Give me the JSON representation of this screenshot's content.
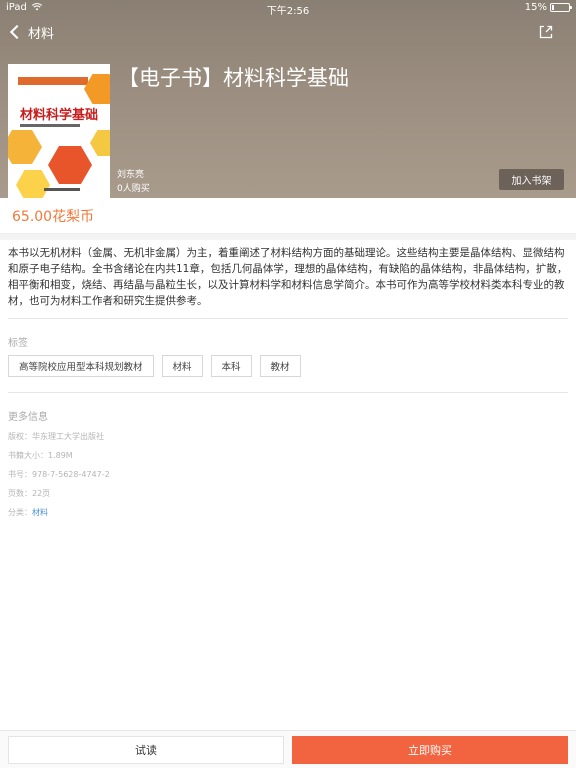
{
  "status_bar": {
    "device": "iPad",
    "time": "下午2:56",
    "battery": "15%",
    "battery_level": 0.15
  },
  "nav": {
    "back_label": "材料",
    "back_icon": "chevron-left-icon",
    "share_icon": "share-icon"
  },
  "book": {
    "title": "【电子书】材料科学基础",
    "cover_title": "材料科学基础",
    "author": "刘东亮",
    "buyers": "0人购买",
    "add_to_shelf": "加入书架",
    "price": "65.00花梨币"
  },
  "description": "本书以无机材料（金属、无机非金属）为主，着重阐述了材料结构方面的基础理论。这些结构主要是晶体结构、显微结构和原子电子结构。全书含绪论在内共11章，包括几何晶体学，理想的晶体结构，有缺陷的晶体结构，非晶体结构，扩散，相平衡和相变，烧结、再结晶与晶粒生长，以及计算材料学和材料信息学简介。本书可作为高等学校材料类本科专业的教材，也可为材料工作者和研究生提供参考。",
  "tags": {
    "title": "标签",
    "items": [
      "高等院校应用型本科规划教材",
      "材料",
      "本科",
      "教材"
    ]
  },
  "more_info": {
    "title": "更多信息",
    "copyright": "版权：华东理工大学出版社",
    "size": "书籍大小：1.89M",
    "isbn": "书号：978-7-5628-4747-2",
    "pages": "页数：22页",
    "category_label": "分类：",
    "category_value": "材料"
  },
  "bottom_bar": {
    "trial": "试读",
    "buy": "立即购买"
  },
  "colors": {
    "accent": "#f2633f",
    "price": "#f07a3a",
    "link": "#4a8fd8"
  }
}
